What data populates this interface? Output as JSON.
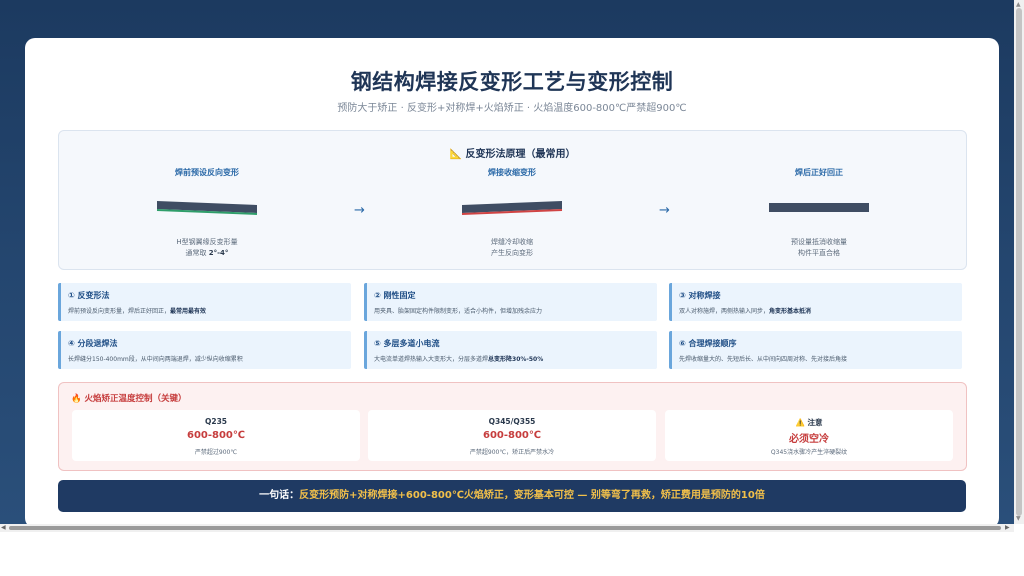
{
  "page": {
    "title": "钢结构焊接反变形工艺与变形控制",
    "subtitle": "预防大于矫正 · 反变形+对称焊+火焰矫正 · 火焰温度600-800℃严禁超900℃"
  },
  "principle": {
    "title": "📐 反变形法原理（最常用）",
    "stages": [
      {
        "label": "焊前预设反向变形",
        "desc_line1": "H型钢翼缘反变形量",
        "desc_prefix": "通常取 ",
        "desc_bold": "2°-4°"
      },
      {
        "label": "焊接收缩变形",
        "desc_line1": "焊缝冷却收缩",
        "desc_line2": "产生反向变形"
      },
      {
        "label": "焊后正好回正",
        "desc_line1": "预设量抵消收缩量",
        "desc_line2": "构件平直合格"
      }
    ],
    "arrow": "→"
  },
  "methods": [
    {
      "title": "① 反变形法",
      "desc": "焊前预设反向变形量，焊后正好回正，",
      "bold": "最常用最有效"
    },
    {
      "title": "② 刚性固定",
      "desc": "用夹具、胎架固定构件限制变形，适合小构件，但增加残余应力",
      "bold": ""
    },
    {
      "title": "③ 对称焊接",
      "desc": "双人对称施焊，两侧热输入同步，",
      "bold": "角变形基本抵消"
    },
    {
      "title": "④ 分段退焊法",
      "desc": "长焊缝分150-400mm段，从中间向两端退焊，减少纵向收缩累积",
      "bold": ""
    },
    {
      "title": "⑤ 多层多道小电流",
      "desc": "大电流单道焊热输入大变形大，分层多道焊",
      "bold": "总变形降30%-50%"
    },
    {
      "title": "⑥ 合理焊接顺序",
      "desc": "先焊收缩量大的、先短后长、从中间向四周对称、先对接后角接",
      "bold": ""
    }
  ],
  "flame": {
    "title": "🔥 火焰矫正温度控制（关键）",
    "boxes": [
      {
        "name": "Q235",
        "value": "600-800℃",
        "note": "严禁超过900℃"
      },
      {
        "name": "Q345/Q355",
        "value": "600-800℃",
        "note": "严禁超900℃，矫正后严禁水冷"
      },
      {
        "name": "⚠️ 注意",
        "value": "必须空冷",
        "note": "Q345浇水骤冷产生淬硬裂纹"
      }
    ]
  },
  "banner": {
    "lead": "一句话：",
    "body": "反变形预防+对称焊接+600-800℃火焰矫正，变形基本可控 — 别等弯了再救，矫正费用是预防的10倍"
  },
  "colors": {
    "header_bg": "#1c3a60",
    "accent_blue": "#2c6aa8",
    "alert_red": "#c63d3d",
    "banner_gold": "#f2c04a",
    "weld_green": "#2f9e6a"
  }
}
